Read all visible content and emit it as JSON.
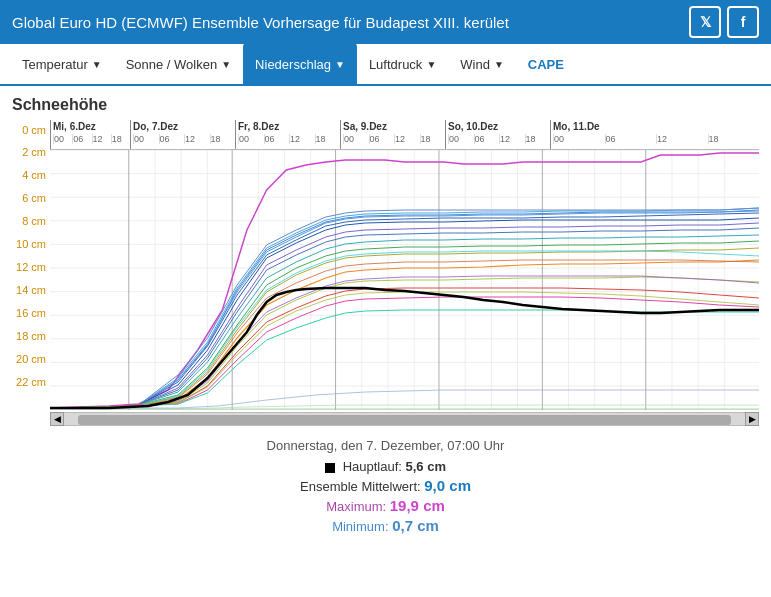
{
  "header": {
    "title": "Global Euro HD (ECMWF) Ensemble Vorhersage für Budapest XIII. kerület",
    "twitter_label": "T",
    "facebook_label": "f"
  },
  "nav": {
    "items": [
      {
        "label": "Temperatur",
        "hasArrow": true,
        "active": false
      },
      {
        "label": "Sonne / Wolken",
        "hasArrow": true,
        "active": false
      },
      {
        "label": "Niederschlag",
        "hasArrow": true,
        "active": true
      },
      {
        "label": "Luftdruck",
        "hasArrow": true,
        "active": false
      },
      {
        "label": "Wind",
        "hasArrow": true,
        "active": false
      },
      {
        "label": "CAPE",
        "hasArrow": false,
        "active": false,
        "special": true
      }
    ]
  },
  "chart": {
    "title": "Schneehöhe",
    "y_labels": [
      "0 cm",
      "2 cm",
      "4 cm",
      "6 cm",
      "8 cm",
      "10 cm",
      "12 cm",
      "14 cm",
      "16 cm",
      "18 cm",
      "20 cm",
      "22 cm"
    ],
    "days": [
      {
        "label": "Mi, 6.Dez",
        "hours": [
          "00",
          "06",
          "12",
          "18"
        ]
      },
      {
        "label": "Do, 7.Dez",
        "hours": [
          "00",
          "06",
          "12",
          "18"
        ]
      },
      {
        "label": "Fr, 8.Dez",
        "hours": [
          "00",
          "06",
          "12",
          "18"
        ]
      },
      {
        "label": "Sa, 9.Dez",
        "hours": [
          "00",
          "06",
          "12",
          "18"
        ]
      },
      {
        "label": "So, 10.Dez",
        "hours": [
          "00",
          "06",
          "12",
          "18"
        ]
      },
      {
        "label": "Mo, 11.De",
        "hours": [
          "00",
          "06",
          "12"
        ]
      }
    ]
  },
  "info": {
    "date": "Donnerstag, den 7. Dezember, 07:00 Uhr",
    "main_label": "Hauptlauf:",
    "main_value": "5,6 cm",
    "ensemble_label": "Ensemble Mittelwert:",
    "ensemble_value": "9,0 cm",
    "max_label": "Maximum:",
    "max_value": "19,9 cm",
    "min_label": "Minimum:",
    "min_value": "0,7 cm"
  },
  "colors": {
    "header_bg": "#1a7abf",
    "active_nav": "#1a7abf",
    "cape_color": "#1a7abf"
  }
}
